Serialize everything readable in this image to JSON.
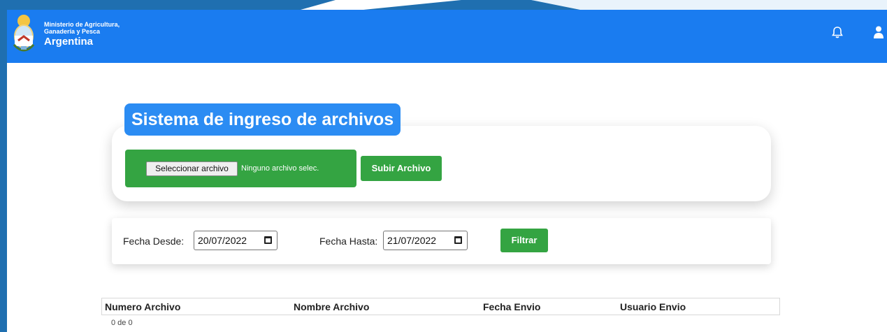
{
  "header": {
    "org_line1": "Ministerio de Agricultura,",
    "org_line2": "Ganadería y Pesca",
    "country": "Argentina",
    "icons": [
      "coat-of-arms-icon",
      "bell-icon",
      "user-icon"
    ]
  },
  "upload": {
    "title": "Sistema de ingreso de archivos",
    "choose_file_label": "Seleccionar archivo",
    "file_status": "Ninguno archivo selec.",
    "submit_label": "Subir Archivo"
  },
  "filter": {
    "from_label": "Fecha Desde:",
    "from_value": "20/07/2022",
    "to_label": "Fecha Hasta:",
    "to_value": "21/07/2022",
    "button_label": "Filtrar"
  },
  "table": {
    "columns": [
      "Numero Archivo",
      "Nombre Archivo",
      "Fecha Envio",
      "Usuario Envio"
    ],
    "rows": [],
    "pagination": "0 de 0"
  },
  "colors": {
    "header_blue": "#1a7cf0",
    "title_blue": "#2b8cf3",
    "action_green": "#34a442",
    "frame_blue": "#1f6fb0"
  }
}
